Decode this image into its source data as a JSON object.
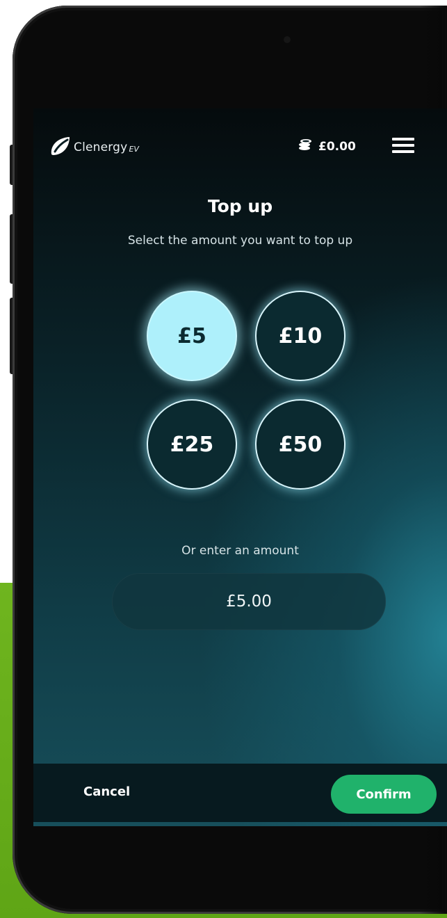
{
  "header": {
    "logo_text": "Clenergy",
    "logo_suffix": "EV",
    "balance": "£0.00"
  },
  "page": {
    "title": "Top up",
    "subtitle": "Select the amount you want to top up"
  },
  "amount_options": [
    {
      "label": "£5",
      "selected": true
    },
    {
      "label": "£10",
      "selected": false
    },
    {
      "label": "£25",
      "selected": false
    },
    {
      "label": "£50",
      "selected": false
    }
  ],
  "custom_amount": {
    "label": "Or enter an amount",
    "value": "£5.00"
  },
  "footer": {
    "cancel_label": "Cancel",
    "confirm_label": "Confirm"
  },
  "colors": {
    "accent_selected": "#aef0fb",
    "confirm_button": "#20b26b",
    "backdrop_green": "#6fb51f"
  },
  "icons": {
    "logo": "leaf-icon",
    "balance": "coins-icon",
    "menu": "hamburger-menu-icon"
  }
}
